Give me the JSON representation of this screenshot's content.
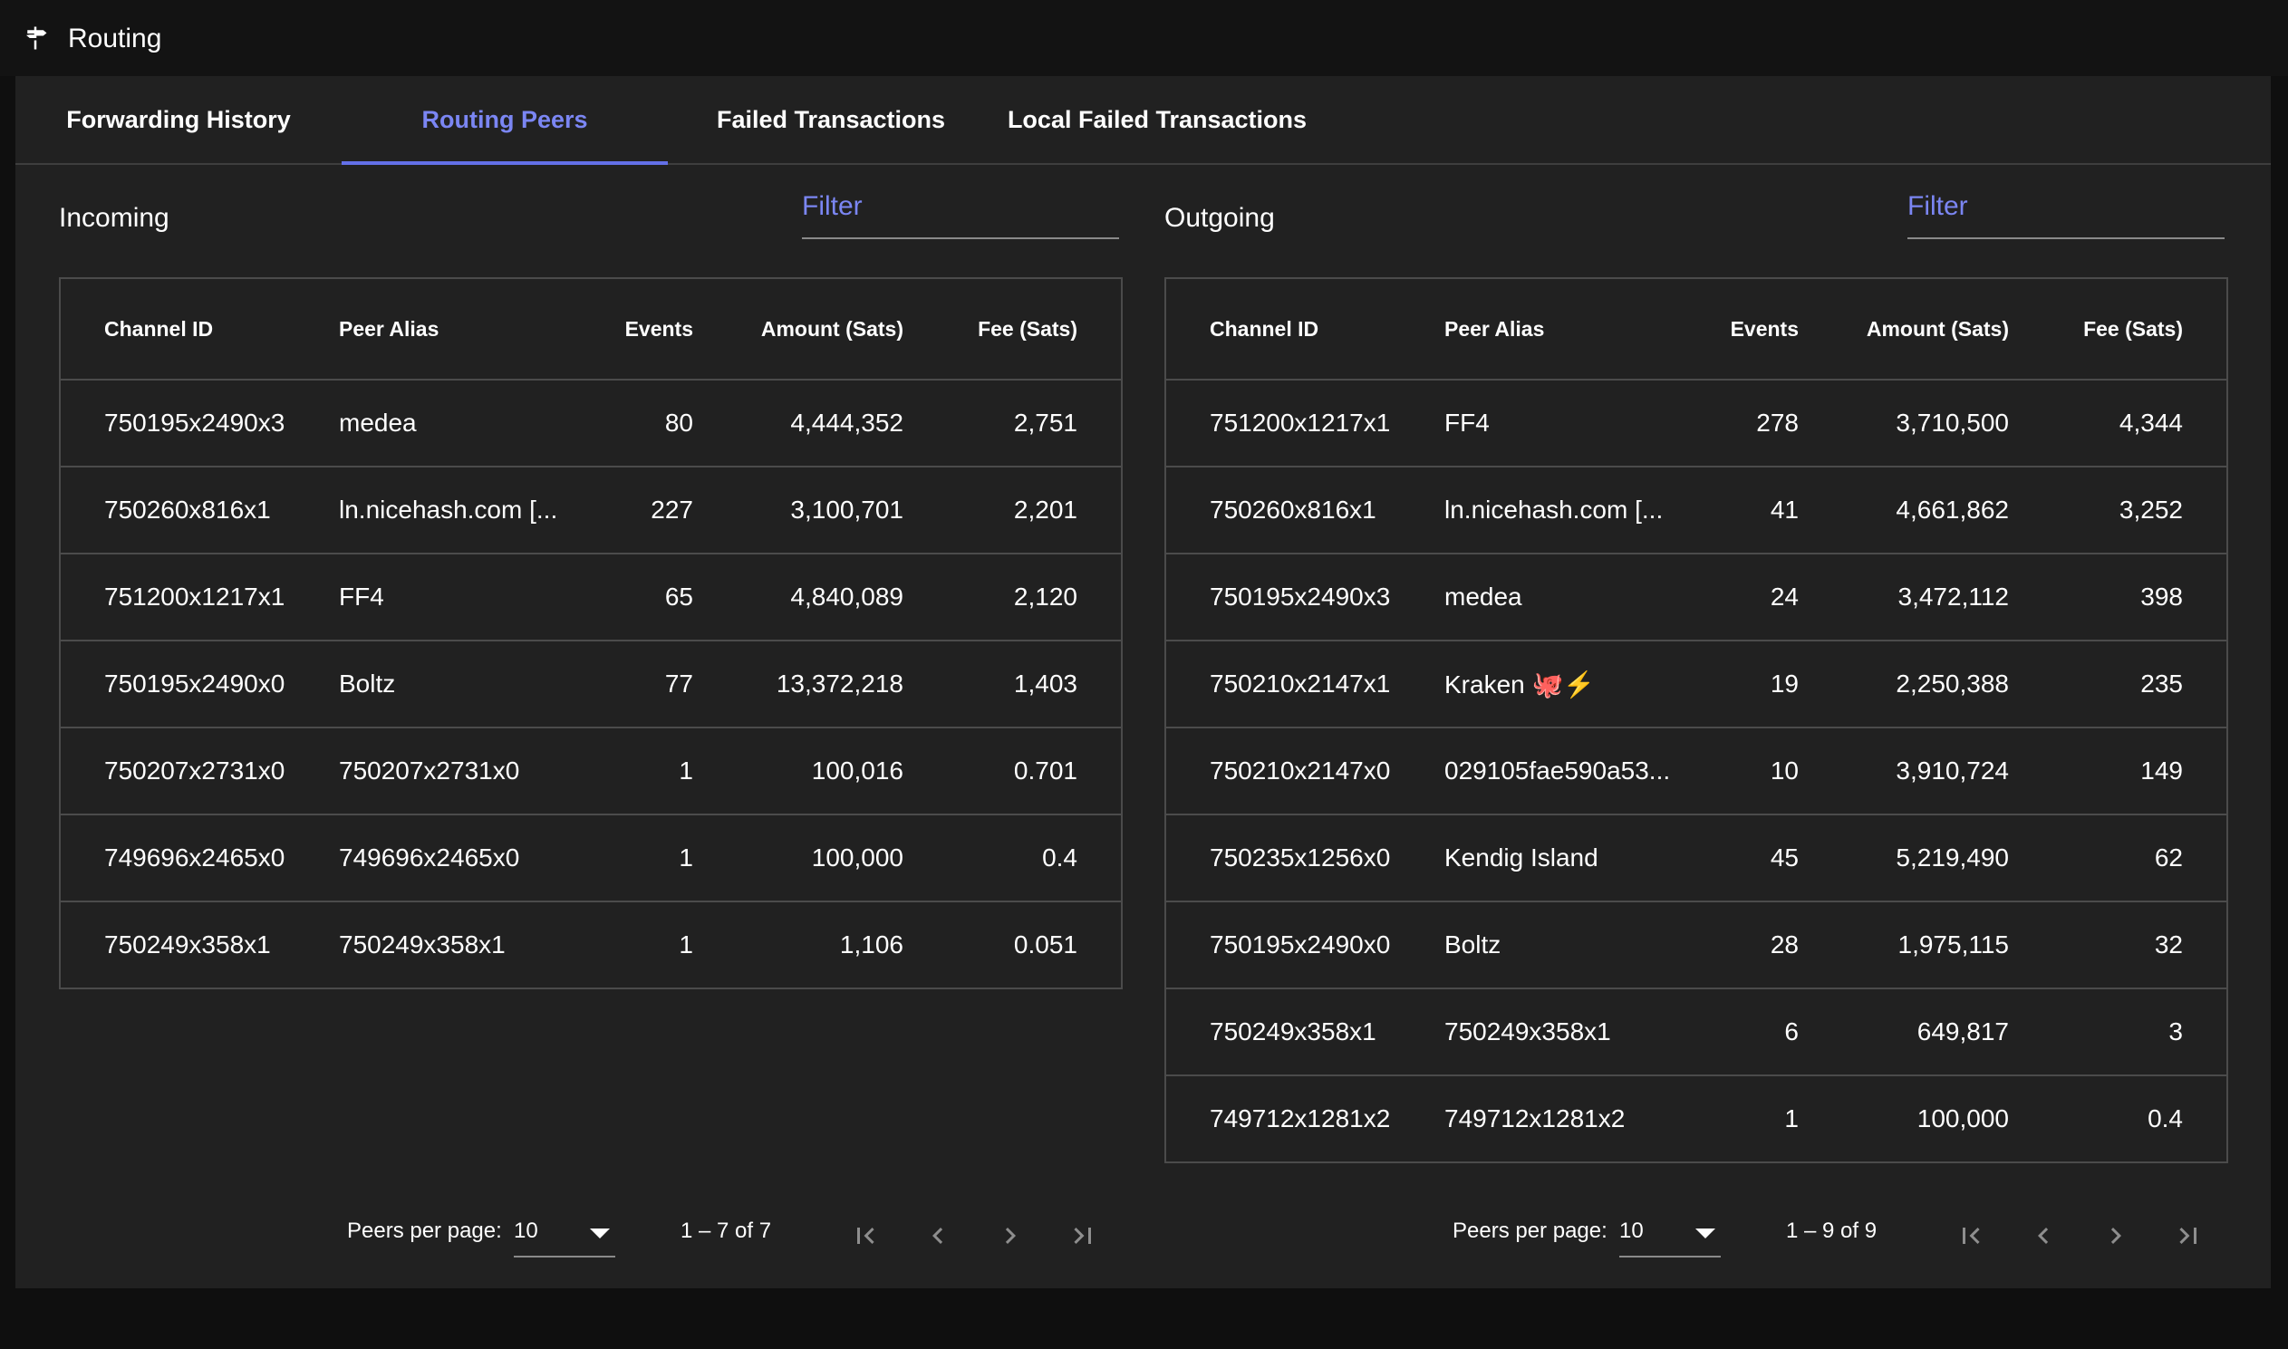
{
  "app": {
    "title": "Routing",
    "icon": "signpost-icon"
  },
  "tabs": [
    {
      "label": "Forwarding History"
    },
    {
      "label": "Routing Peers"
    },
    {
      "label": "Failed Transactions"
    },
    {
      "label": "Local Failed Transactions"
    }
  ],
  "active_tab": "Routing Peers",
  "accent_color": "#6370e8",
  "incoming": {
    "title": "Incoming",
    "filter_placeholder": "Filter",
    "columns": [
      "Channel ID",
      "Peer Alias",
      "Events",
      "Amount (Sats)",
      "Fee (Sats)"
    ],
    "rows": [
      [
        "750195x2490x3",
        "medea",
        "80",
        "4,444,352",
        "2,751"
      ],
      [
        "750260x816x1",
        "ln.nicehash.com [...",
        "227",
        "3,100,701",
        "2,201"
      ],
      [
        "751200x1217x1",
        "FF4",
        "65",
        "4,840,089",
        "2,120"
      ],
      [
        "750195x2490x0",
        "Boltz",
        "77",
        "13,372,218",
        "1,403"
      ],
      [
        "750207x2731x0",
        "750207x2731x0",
        "1",
        "100,016",
        "0.701"
      ],
      [
        "749696x2465x0",
        "749696x2465x0",
        "1",
        "100,000",
        "0.4"
      ],
      [
        "750249x358x1",
        "750249x358x1",
        "1",
        "1,106",
        "0.051"
      ]
    ],
    "pager": {
      "label": "Peers per page:",
      "per_page": "10",
      "range": "1 – 7 of 7"
    }
  },
  "outgoing": {
    "title": "Outgoing",
    "filter_placeholder": "Filter",
    "columns": [
      "Channel ID",
      "Peer Alias",
      "Events",
      "Amount (Sats)",
      "Fee (Sats)"
    ],
    "rows": [
      [
        "751200x1217x1",
        "FF4",
        "278",
        "3,710,500",
        "4,344"
      ],
      [
        "750260x816x1",
        "ln.nicehash.com [...",
        "41",
        "4,661,862",
        "3,252"
      ],
      [
        "750195x2490x3",
        "medea",
        "24",
        "3,472,112",
        "398"
      ],
      [
        "750210x2147x1",
        "Kraken 🐙⚡",
        "19",
        "2,250,388",
        "235"
      ],
      [
        "750210x2147x0",
        "029105fae590a53...",
        "10",
        "3,910,724",
        "149"
      ],
      [
        "750235x1256x0",
        "Kendig Island",
        "45",
        "5,219,490",
        "62"
      ],
      [
        "750195x2490x0",
        "Boltz",
        "28",
        "1,975,115",
        "32"
      ],
      [
        "750249x358x1",
        "750249x358x1",
        "6",
        "649,817",
        "3"
      ],
      [
        "749712x1281x2",
        "749712x1281x2",
        "1",
        "100,000",
        "0.4"
      ]
    ],
    "pager": {
      "label": "Peers per page:",
      "per_page": "10",
      "range": "1 – 9 of 9"
    }
  }
}
